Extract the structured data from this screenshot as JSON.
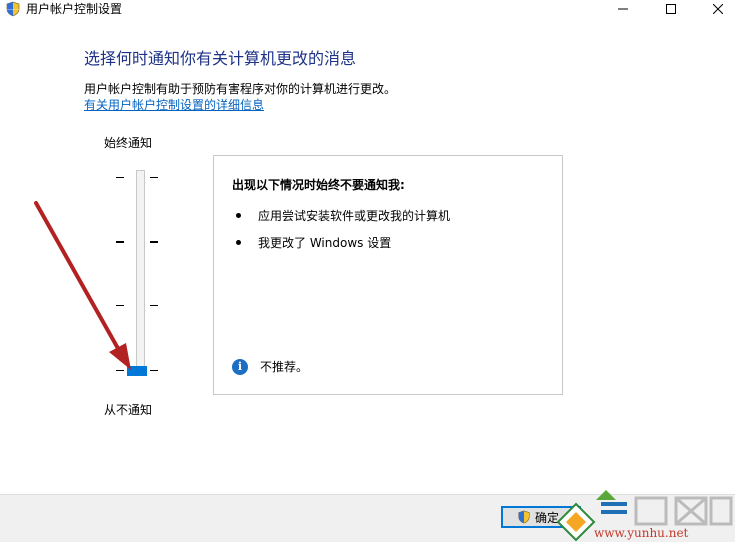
{
  "window": {
    "title": "用户帐户控制设置",
    "icon": "uac-shield-icon"
  },
  "main": {
    "heading": "选择何时通知你有关计算机更改的消息",
    "description": "用户帐户控制有助于预防有害程序对你的计算机进行更改。",
    "link": "有关用户帐户控制设置的详细信息"
  },
  "slider": {
    "label_top": "始终通知",
    "label_bottom": "从不通知",
    "level_count": 4,
    "selected_level": 4
  },
  "info_box": {
    "title": "出现以下情况时始终不要通知我:",
    "bullets": [
      "应用尝试安装软件或更改我的计算机",
      "我更改了 Windows 设置"
    ],
    "note": "不推荐。"
  },
  "footer": {
    "ok_label": "确定"
  },
  "watermark": {
    "text": "www.yunhu.net"
  },
  "colors": {
    "heading": "#1e3287",
    "link": "#0563c1",
    "accent": "#0078d7",
    "arrow": "#b22222"
  }
}
